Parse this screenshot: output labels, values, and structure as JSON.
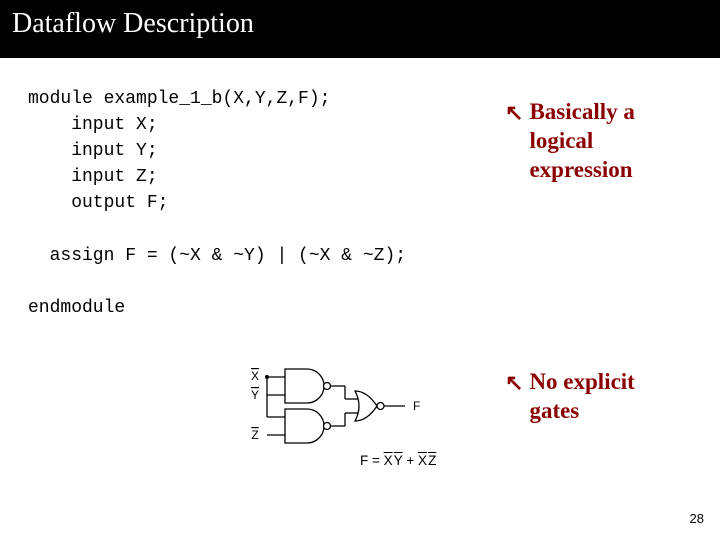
{
  "header": {
    "title": "Dataflow Description"
  },
  "code": {
    "l1": "module example_1_b(X,Y,Z,F);",
    "l2": "    input X;",
    "l3": "    input Y;",
    "l4": "    input Z;",
    "l5": "    output F;",
    "blank1": "",
    "l6": "  assign F = (~X & ~Y) | (~X & ~Z);",
    "blank2": "",
    "l7": "endmodule"
  },
  "annot": {
    "a1_1": "Basically a",
    "a1_2": "logical",
    "a1_3": "expression",
    "a2_1": "No explicit",
    "a2_2": "gates"
  },
  "diagram": {
    "sigX": "X",
    "sigY": "Y",
    "sigZ": "Z",
    "sigF": "F",
    "formula_lhs": "F = ",
    "formula_t1a": "X",
    "formula_t1b": "Y",
    "formula_plus": " + ",
    "formula_t2a": "X",
    "formula_t2b": "Z"
  },
  "page": {
    "num": "28"
  }
}
